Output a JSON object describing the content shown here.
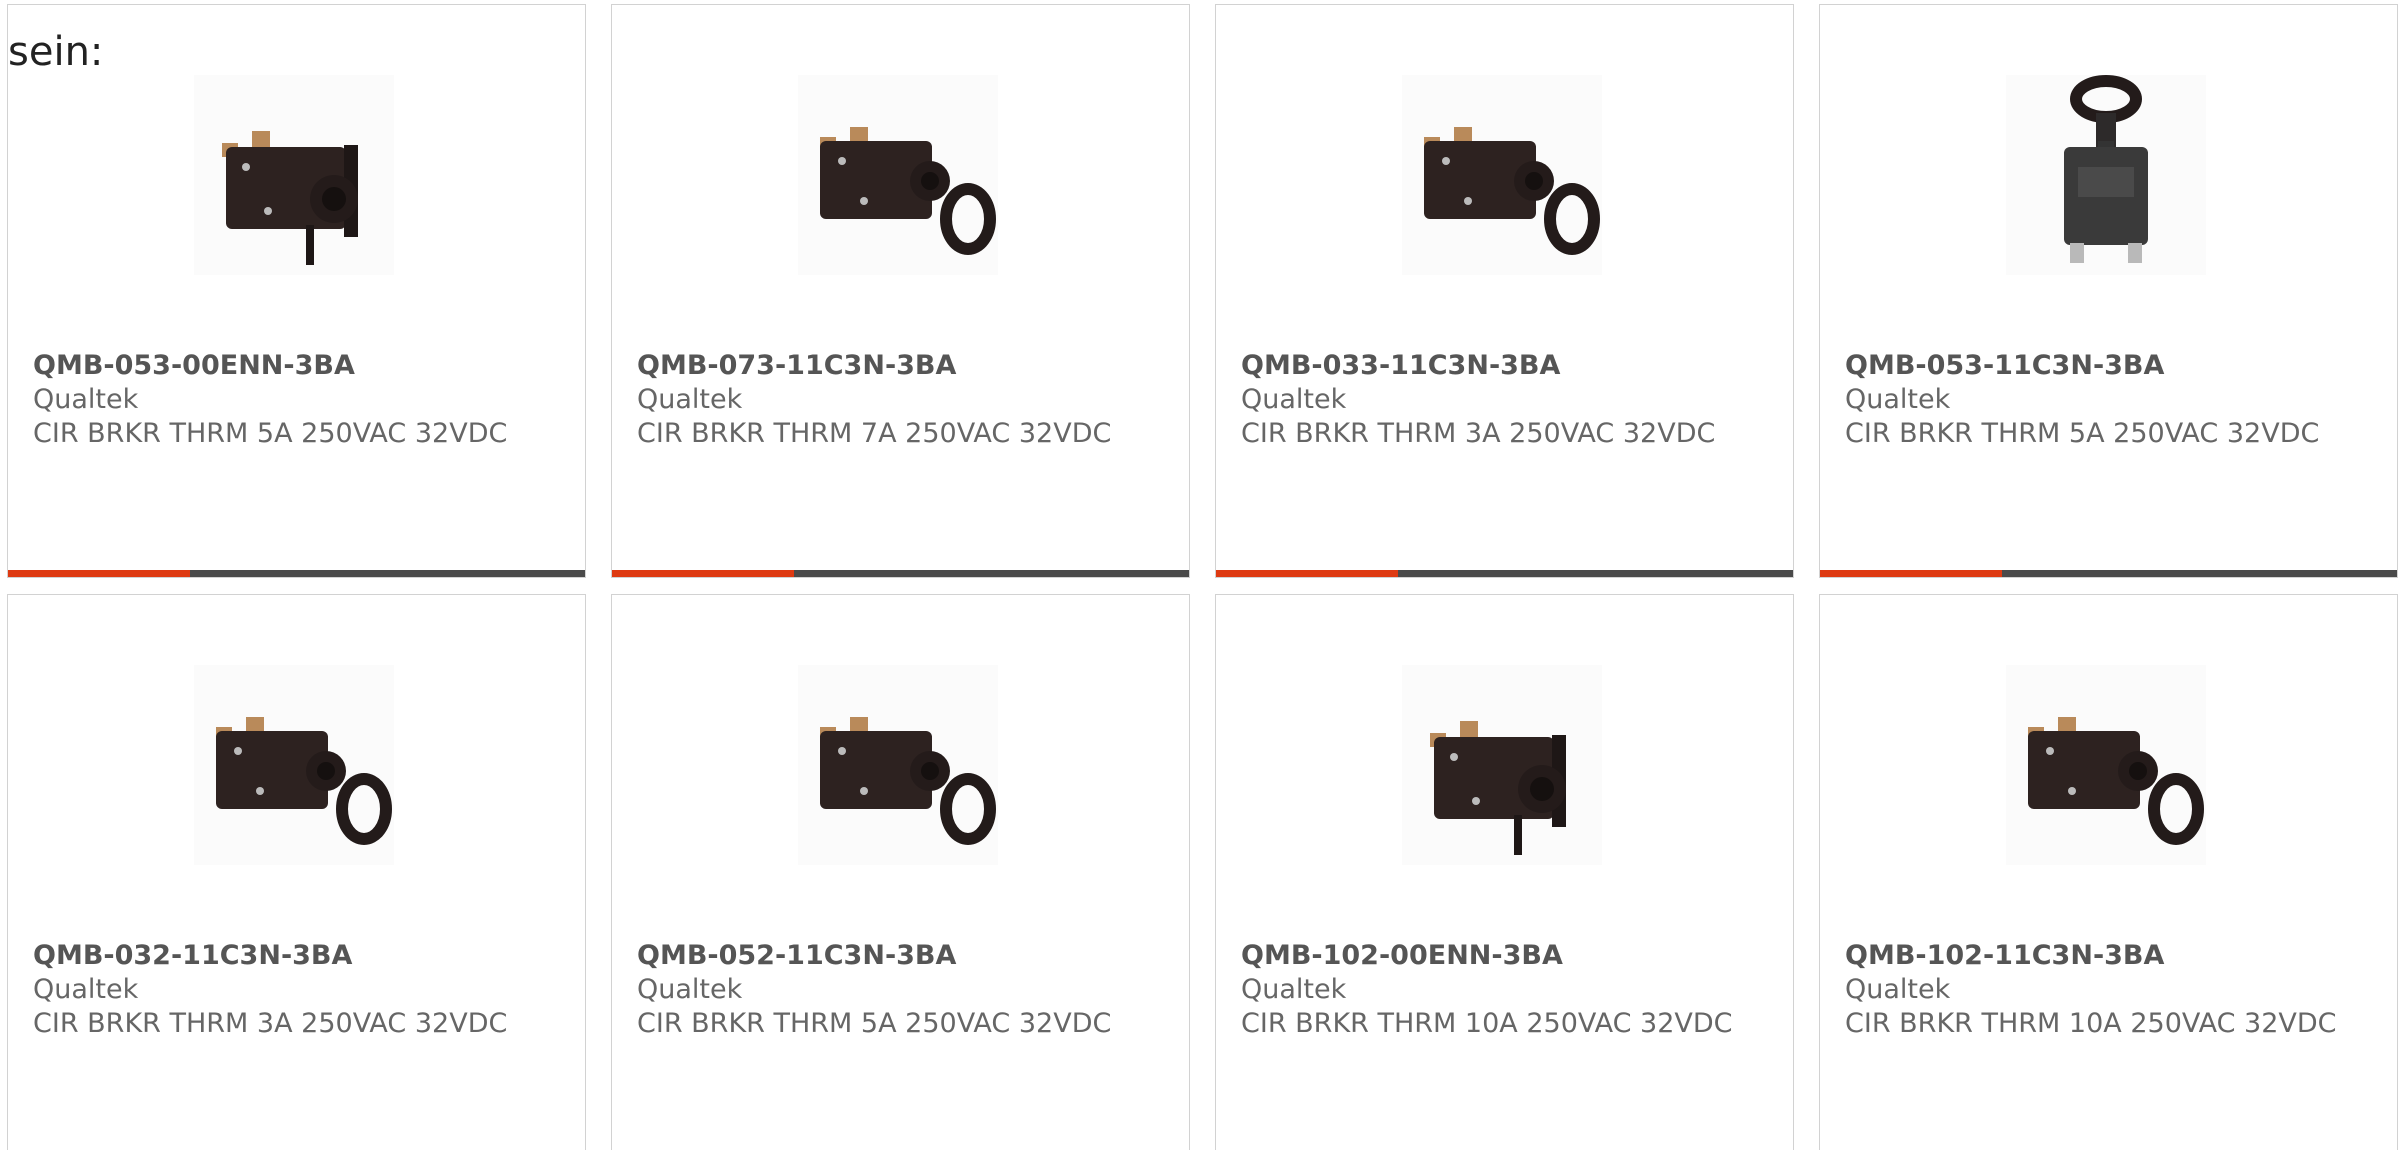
{
  "intro_text": "sein:",
  "colors": {
    "accent": "#de3a12",
    "bar": "#4a4a4a",
    "border": "#d2d2d2",
    "text": "#666666"
  },
  "products": [
    {
      "part_number": "QMB-053-00ENN-3BA",
      "manufacturer": "Qualtek",
      "description": "CIR BRKR THRM 5A 250VAC 32VDC",
      "image_icon": "circuit-breaker-flange-icon"
    },
    {
      "part_number": "QMB-073-11C3N-3BA",
      "manufacturer": "Qualtek",
      "description": "CIR BRKR THRM 7A 250VAC 32VDC",
      "image_icon": "circuit-breaker-oring-icon"
    },
    {
      "part_number": "QMB-033-11C3N-3BA",
      "manufacturer": "Qualtek",
      "description": "CIR BRKR THRM 3A 250VAC 32VDC",
      "image_icon": "circuit-breaker-oring-icon"
    },
    {
      "part_number": "QMB-053-11C3N-3BA",
      "manufacturer": "Qualtek",
      "description": "CIR BRKR THRM 5A 250VAC 32VDC",
      "image_icon": "circuit-breaker-front-icon"
    },
    {
      "part_number": "QMB-032-11C3N-3BA",
      "manufacturer": "Qualtek",
      "description": "CIR BRKR THRM 3A 250VAC 32VDC",
      "image_icon": "circuit-breaker-oring-icon"
    },
    {
      "part_number": "QMB-052-11C3N-3BA",
      "manufacturer": "Qualtek",
      "description": "CIR BRKR THRM 5A 250VAC 32VDC",
      "image_icon": "circuit-breaker-oring-icon"
    },
    {
      "part_number": "QMB-102-00ENN-3BA",
      "manufacturer": "Qualtek",
      "description": "CIR BRKR THRM 10A 250VAC 32VDC",
      "image_icon": "circuit-breaker-flange-icon"
    },
    {
      "part_number": "QMB-102-11C3N-3BA",
      "manufacturer": "Qualtek",
      "description": "CIR BRKR THRM 10A 250VAC 32VDC",
      "image_icon": "circuit-breaker-oring-icon"
    }
  ]
}
